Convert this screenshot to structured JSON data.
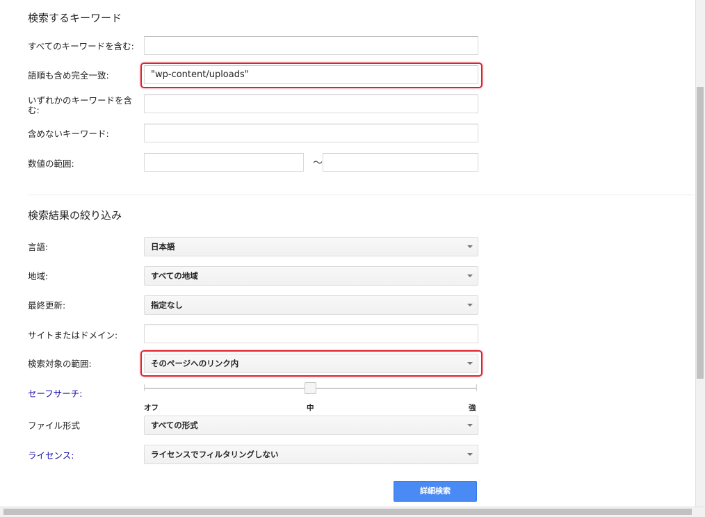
{
  "keywords": {
    "heading": "検索するキーワード",
    "all_words_label": "すべてのキーワードを含む:",
    "all_words_value": "",
    "exact_phrase_label": "語順も含め完全一致:",
    "exact_phrase_value": "\"wp-content/uploads\"",
    "any_words_label": "いずれかのキーワードを含む:",
    "any_words_value": "",
    "none_words_label": "含めないキーワード:",
    "none_words_value": "",
    "range_label": "数値の範囲:",
    "range_from": "",
    "range_to": "",
    "range_sep": "〜"
  },
  "filters": {
    "heading": "検索結果の絞り込み",
    "language_label": "言語:",
    "language_value": "日本語",
    "region_label": "地域:",
    "region_value": "すべての地域",
    "updated_label": "最終更新:",
    "updated_value": "指定なし",
    "site_label": "サイトまたはドメイン:",
    "site_value": "",
    "where_label": "検索対象の範囲:",
    "where_value": "そのページへのリンク内",
    "safesearch_label": "セーフサーチ:",
    "safesearch_level": "中",
    "safesearch_ticks": [
      "オフ",
      "中",
      "強"
    ],
    "filetype_label": "ファイル形式",
    "filetype_value": "すべての形式",
    "license_label": "ライセンス:",
    "license_value": "ライセンスでフィルタリングしない"
  },
  "actions": {
    "advanced_search": "詳細検索"
  },
  "colors": {
    "highlight": "#e0212b",
    "link": "#1a0dab",
    "button": "#4a8af4"
  }
}
